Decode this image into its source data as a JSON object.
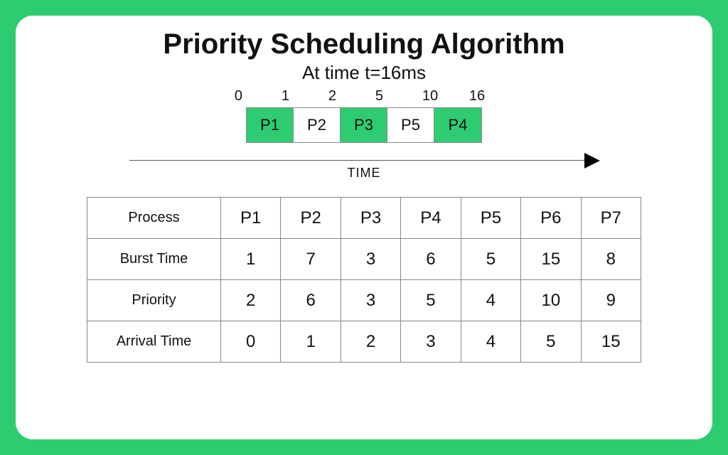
{
  "title": "Priority Scheduling Algorithm",
  "subtitle": "At time t=16ms",
  "time_axis_label": "TIME",
  "gantt": {
    "ticks": [
      "0",
      "1",
      "2",
      "5",
      "10",
      "16"
    ],
    "cells": [
      {
        "label": "P1",
        "filled": true
      },
      {
        "label": "P2",
        "filled": false
      },
      {
        "label": "P3",
        "filled": true
      },
      {
        "label": "P5",
        "filled": false
      },
      {
        "label": "P4",
        "filled": true
      }
    ]
  },
  "table": {
    "row_headers": [
      "Process",
      "Burst Time",
      "Priority",
      "Arrival Time"
    ],
    "columns": [
      "P1",
      "P2",
      "P3",
      "P4",
      "P5",
      "P6",
      "P7"
    ],
    "rows": {
      "burst_time": [
        "1",
        "7",
        "3",
        "6",
        "5",
        "15",
        "8"
      ],
      "priority": [
        "2",
        "6",
        "3",
        "5",
        "4",
        "10",
        "9"
      ],
      "arrival_time": [
        "0",
        "1",
        "2",
        "3",
        "4",
        "5",
        "15"
      ]
    }
  },
  "colors": {
    "accent": "#2ecc71"
  }
}
